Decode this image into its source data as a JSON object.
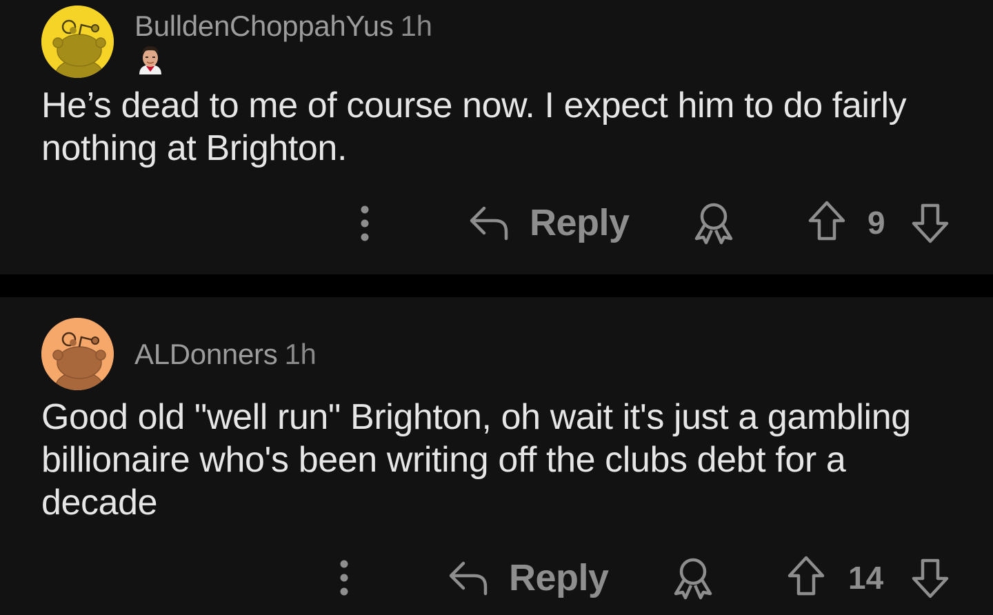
{
  "comments": [
    {
      "username": "BulldenChoppahYus",
      "timestamp": "1h",
      "avatar_color": "#f5d427",
      "has_flair": true,
      "flair_icon": "player-face-icon",
      "body": "He’s dead to me of course now. I expect him to do fairly nothing at Brighton.",
      "reply_label": "Reply",
      "votes": "9"
    },
    {
      "username": "ALDonners",
      "timestamp": "1h",
      "avatar_color": "#f5a86a",
      "has_flair": false,
      "body": "Good old \"well run\" Brighton, oh wait it's just a gambling billionaire who's been writing off the clubs debt for a decade",
      "reply_label": "Reply",
      "votes": "14"
    }
  ],
  "icons": {
    "more": "more-vertical-icon",
    "reply": "reply-arrow-icon",
    "award": "award-icon",
    "upvote": "upvote-arrow-icon",
    "downvote": "downvote-arrow-icon"
  },
  "colors": {
    "background": "#000000",
    "card": "#121212",
    "text": "#e6e6e6",
    "muted": "#8e8e8e"
  }
}
